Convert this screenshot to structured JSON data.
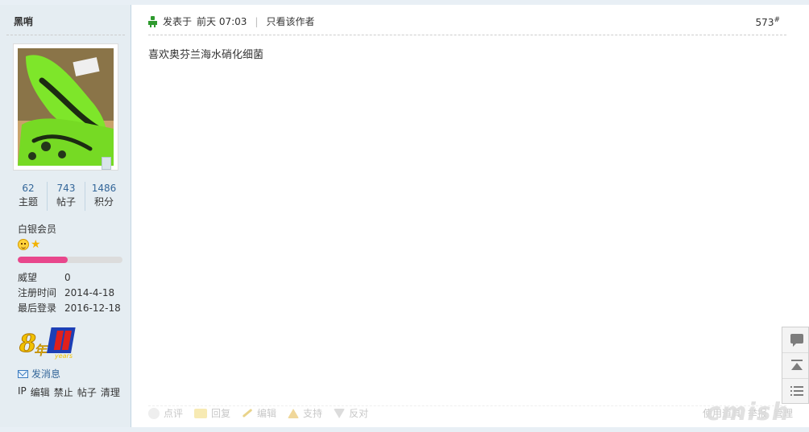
{
  "profile": {
    "username": "黑哨",
    "stats": [
      {
        "value": "62",
        "label": "主题"
      },
      {
        "value": "743",
        "label": "帖子"
      },
      {
        "value": "1486",
        "label": "积分"
      }
    ],
    "group": "白银会员",
    "level_progress_percent": 48,
    "info": [
      {
        "key": "威望",
        "value": "0"
      },
      {
        "key": "注册时间",
        "value": "2014-4-18"
      },
      {
        "key": "最后登录",
        "value": "2016-12-18"
      }
    ],
    "send_message": "发消息",
    "admin_links": [
      "IP",
      "编辑",
      "禁止",
      "帖子",
      "清理"
    ]
  },
  "post": {
    "posted_prefix": "发表于",
    "posted_time": "前天 07:03",
    "only_author": "只看该作者",
    "floor_number": "573",
    "floor_suffix": "#",
    "content": "喜欢奥芬兰海水硝化细菌"
  },
  "footer": {
    "actions": [
      {
        "label": "点评",
        "icon": "comment-icon"
      },
      {
        "label": "回复",
        "icon": "reply-icon"
      },
      {
        "label": "编辑",
        "icon": "edit-icon"
      },
      {
        "label": "支持",
        "icon": "thumbs-up-icon"
      },
      {
        "label": "反对",
        "icon": "thumbs-down-icon"
      }
    ],
    "right_links": [
      "使用道具",
      "举报",
      "管理"
    ],
    "watermark": "cmish"
  },
  "colors": {
    "sidebar_bg": "#e5edf2",
    "link_blue": "#336699",
    "progress_pink": "#e8478c"
  }
}
